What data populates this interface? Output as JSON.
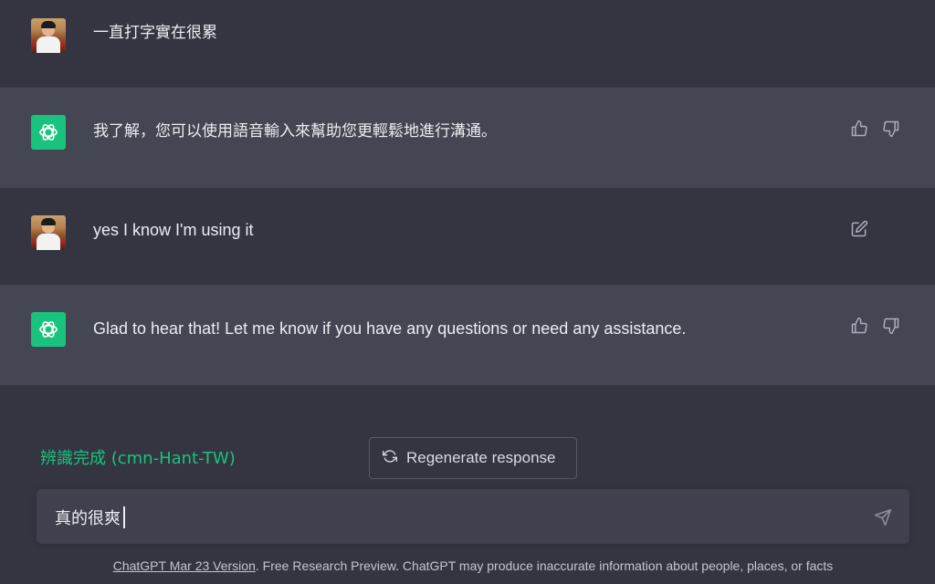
{
  "messages": [
    {
      "role": "user",
      "text": "一直打字實在很累"
    },
    {
      "role": "assistant",
      "text": "我了解，您可以使用語音輸入來幫助您更輕鬆地進行溝通。"
    },
    {
      "role": "user",
      "text": "yes I know I'm using it"
    },
    {
      "role": "assistant",
      "text": "Glad to hear that! Let me know if you have any questions or need any assistance."
    }
  ],
  "status": {
    "text": "辨識完成 (cmn-Hant-TW)",
    "color": "#19c37d"
  },
  "regenerate": {
    "label": "Regenerate response",
    "icon": "refresh-icon"
  },
  "input": {
    "value": "真的很爽",
    "send_icon": "send-icon"
  },
  "footer": {
    "link_text": "ChatGPT Mar 23 Version",
    "text": ". Free Research Preview. ChatGPT may produce inaccurate information about people, places, or facts"
  },
  "colors": {
    "background": "#343541",
    "assistant_row": "#444654",
    "accent": "#19c37d",
    "input_bg": "#40414f"
  },
  "icons": {
    "thumbs_up": "thumbs-up-icon",
    "thumbs_down": "thumbs-down-icon",
    "edit": "edit-icon",
    "openai_logo": "openai-logo-icon"
  }
}
